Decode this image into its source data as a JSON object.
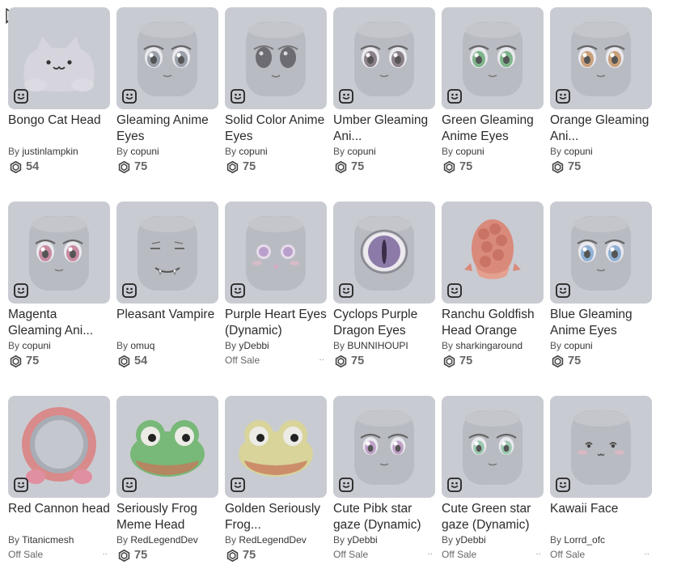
{
  "items": [
    {
      "name": "Bongo Cat Head",
      "creator": "justinlampkin",
      "price": "54",
      "art": "cat"
    },
    {
      "name": "Gleaming Anime Eyes",
      "creator": "copuni",
      "price": "75",
      "art": "eyes",
      "iris": "#9aa0aa"
    },
    {
      "name": "Solid Color Anime Eyes",
      "creator": "copuni",
      "price": "75",
      "art": "solid"
    },
    {
      "name": "Umber Gleaming Ani...",
      "creator": "copuni",
      "price": "75",
      "art": "eyes",
      "iris": "#8a8088"
    },
    {
      "name": "Green Gleaming Anime Eyes",
      "creator": "copuni",
      "price": "75",
      "art": "eyes",
      "iris": "#7fb48a"
    },
    {
      "name": "Orange Gleaming Ani...",
      "creator": "copuni",
      "price": "75",
      "art": "eyes",
      "iris": "#c9a07a"
    },
    {
      "name": "Magenta Gleaming Ani...",
      "creator": "copuni",
      "price": "75",
      "art": "eyes",
      "iris": "#c88aa0"
    },
    {
      "name": "Pleasant Vampire",
      "creator": "omuq",
      "price": "54",
      "art": "vampire"
    },
    {
      "name": "Purple Heart Eyes (Dynamic)",
      "creator": "yDebbi",
      "offsale": "Off Sale",
      "art": "heart"
    },
    {
      "name": "Cyclops Purple Dragon Eyes",
      "creator": "BUNNIHOUPI",
      "price": "75",
      "art": "cyclops"
    },
    {
      "name": "Ranchu Goldfish Head Orange",
      "creator": "sharkingaround",
      "price": "75",
      "art": "goldfish"
    },
    {
      "name": "Blue Gleaming Anime Eyes",
      "creator": "copuni",
      "price": "75",
      "art": "eyes",
      "iris": "#8fb0d4"
    },
    {
      "name": "Red Cannon head",
      "creator": "Titanicmesh",
      "offsale": "Off Sale",
      "art": "cannon"
    },
    {
      "name": "Seriously Frog Meme Head",
      "creator": "RedLegendDev",
      "price": "75",
      "art": "frog",
      "skin": "#78b878"
    },
    {
      "name": "Golden Seriously Frog...",
      "creator": "RedLegendDev",
      "price": "75",
      "art": "frog",
      "skin": "#d8d49a"
    },
    {
      "name": "Cute Pibk star gaze (Dynamic)",
      "creator": "yDebbi",
      "offsale": "Off Sale",
      "art": "gaze",
      "iris": "#c0a0c8"
    },
    {
      "name": "Cute Green star gaze (Dynamic)",
      "creator": "yDebbi",
      "offsale": "Off Sale",
      "art": "gaze",
      "iris": "#9cc8b0"
    },
    {
      "name": "Kawaii Face",
      "creator": "Lorrd_ofc",
      "offsale": "Off Sale",
      "art": "kawaii"
    }
  ],
  "labels": {
    "by": "By",
    "more": "··"
  },
  "colors": {
    "thumb_bg": "#c9cbd2",
    "head": "#b9bbc2",
    "text": "#2b2b2b",
    "muted": "#666666"
  }
}
